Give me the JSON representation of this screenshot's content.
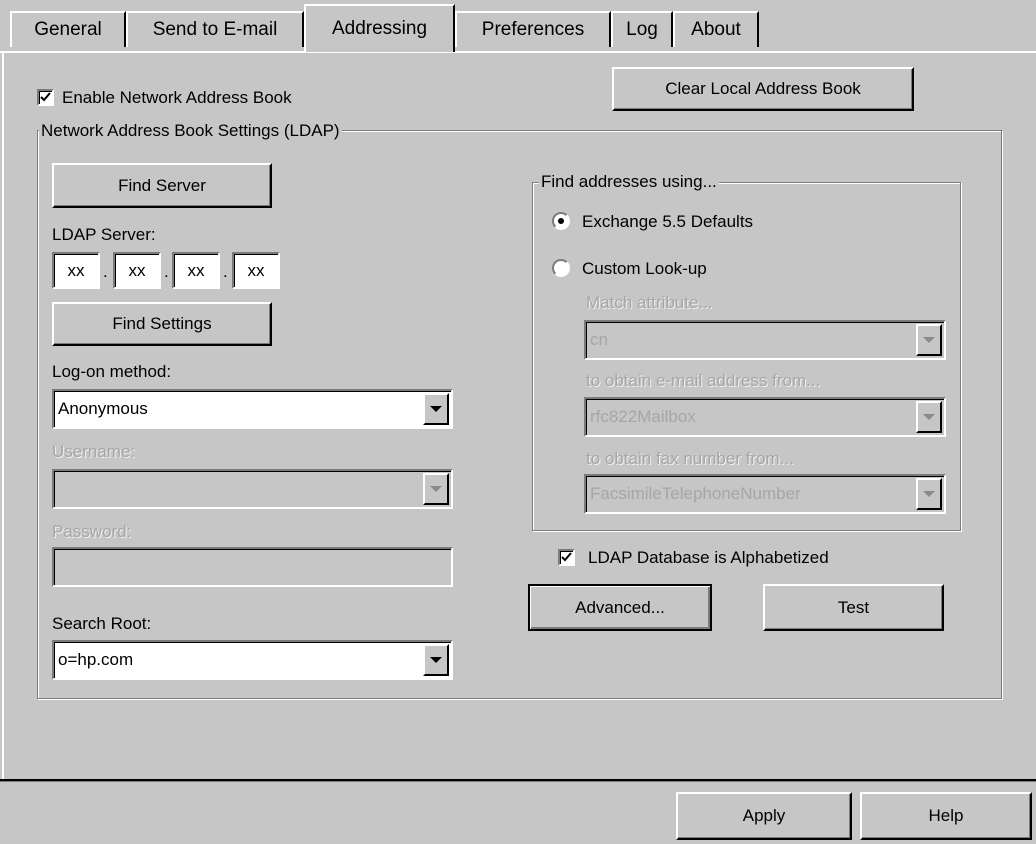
{
  "tabs": [
    "General",
    "Send to E-mail",
    "Addressing",
    "Preferences",
    "Log",
    "About"
  ],
  "active_tab": "Addressing",
  "enable_network_address_book": {
    "label": "Enable Network Address Book",
    "checked": true
  },
  "clear_local_address_book": "Clear Local Address Book",
  "ldap_group": {
    "title": "Network Address Book Settings (LDAP)",
    "find_server": "Find Server",
    "ldap_server_label": "LDAP Server:",
    "ip_octets": [
      "xx",
      "xx",
      "xx",
      "xx"
    ],
    "ip_separator": ".",
    "find_settings": "Find Settings",
    "logon_label": "Log-on method:",
    "logon_value": "Anonymous",
    "username_label": "Username:",
    "username_value": "",
    "password_label": "Password:",
    "password_value": "",
    "search_root_label": "Search Root:",
    "search_root_value": "o=hp.com"
  },
  "find_group": {
    "title": "Find addresses using...",
    "option_defaults": "Exchange 5.5 Defaults",
    "option_custom": "Custom Look-up",
    "selected": "Exchange 5.5 Defaults",
    "match_label": "Match attribute...",
    "match_value": "cn",
    "email_label": "to obtain e-mail address from...",
    "email_value": "rfc822Mailbox",
    "fax_label": "to obtain fax number from...",
    "fax_value": "FacsimileTelephoneNumber"
  },
  "ldap_alphabetized": {
    "label": "LDAP Database is Alphabetized",
    "checked": true
  },
  "advanced_button": "Advanced...",
  "test_button": "Test",
  "footer": {
    "apply": "Apply",
    "help": "Help"
  },
  "icons": {
    "checkbox": "check-icon",
    "dropdown": "chevron-down-icon",
    "radio": "radio-dot-icon"
  }
}
